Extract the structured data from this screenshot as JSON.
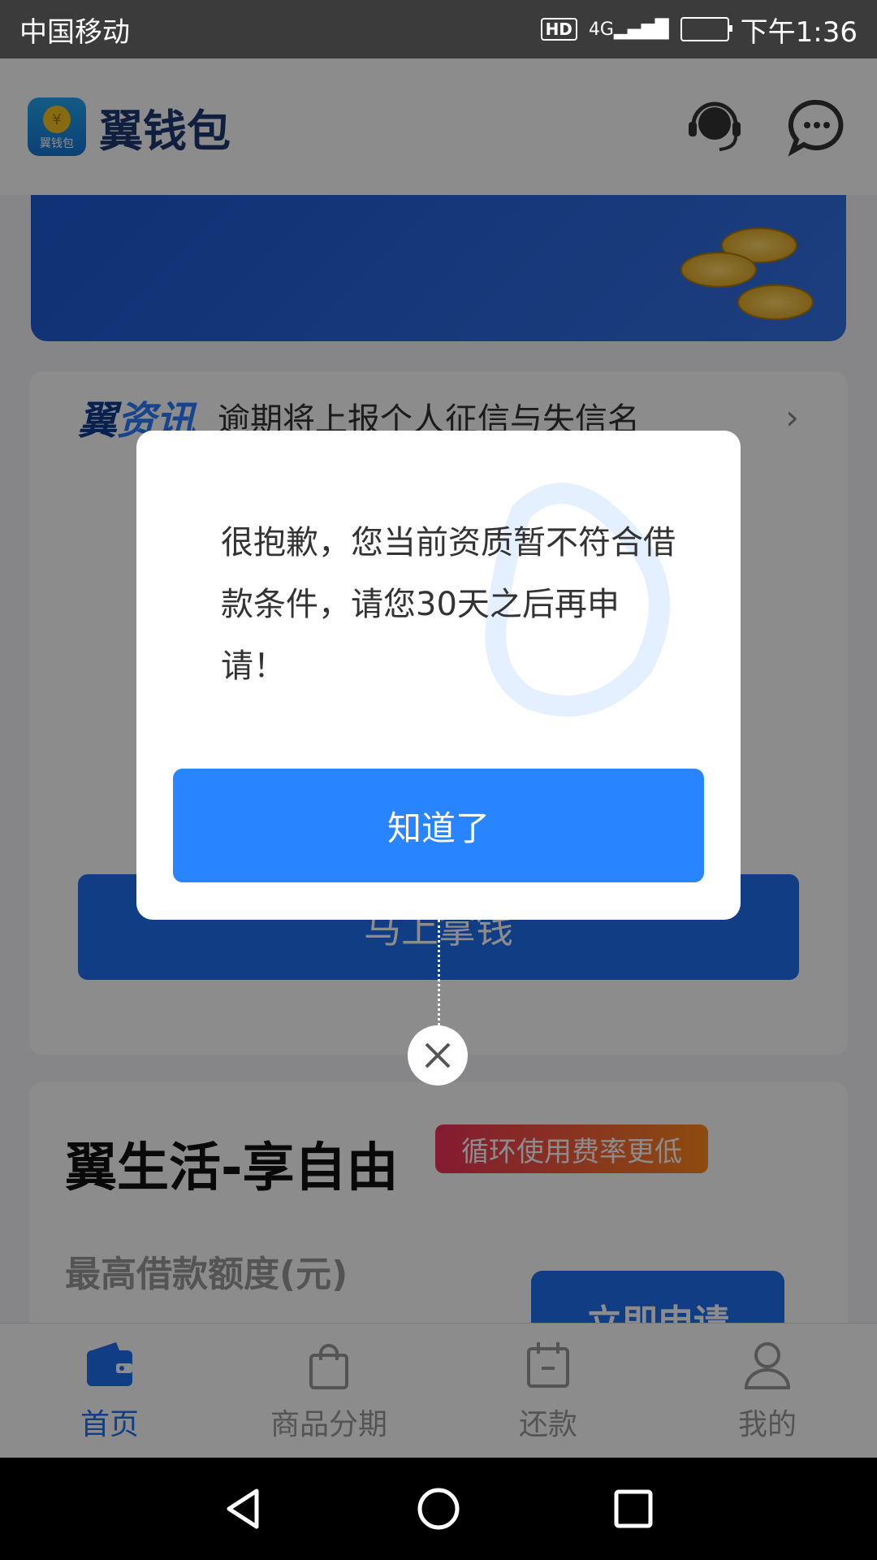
{
  "status_bar": {
    "carrier": "中国移动",
    "hd": "HD",
    "network": "4G",
    "time": "下午1:36"
  },
  "header": {
    "logo_caption": "翼钱包",
    "logo_coin": "¥",
    "app_name": "翼钱包"
  },
  "news": {
    "brand_part1": "翼",
    "brand_part2": "资讯",
    "text": "逾期将上报个人征信与失信名",
    "chevron": "›"
  },
  "loan_card": {
    "button": "马上拿钱"
  },
  "life_card": {
    "title": "翼生活-享自由",
    "tag": "循环使用费率更低",
    "subtitle": "最高借款额度(元)",
    "apply_button": "立即申请"
  },
  "bottom_nav": [
    {
      "label": "首页"
    },
    {
      "label": "商品分期"
    },
    {
      "label": "还款"
    },
    {
      "label": "我的"
    }
  ],
  "dialog": {
    "message": "很抱歉，您当前资质暂不符合借款条件，请您30天之后再申请！",
    "confirm": "知道了"
  },
  "colors": {
    "primary": "#2885ff",
    "brand_dark": "#1e3a74"
  }
}
